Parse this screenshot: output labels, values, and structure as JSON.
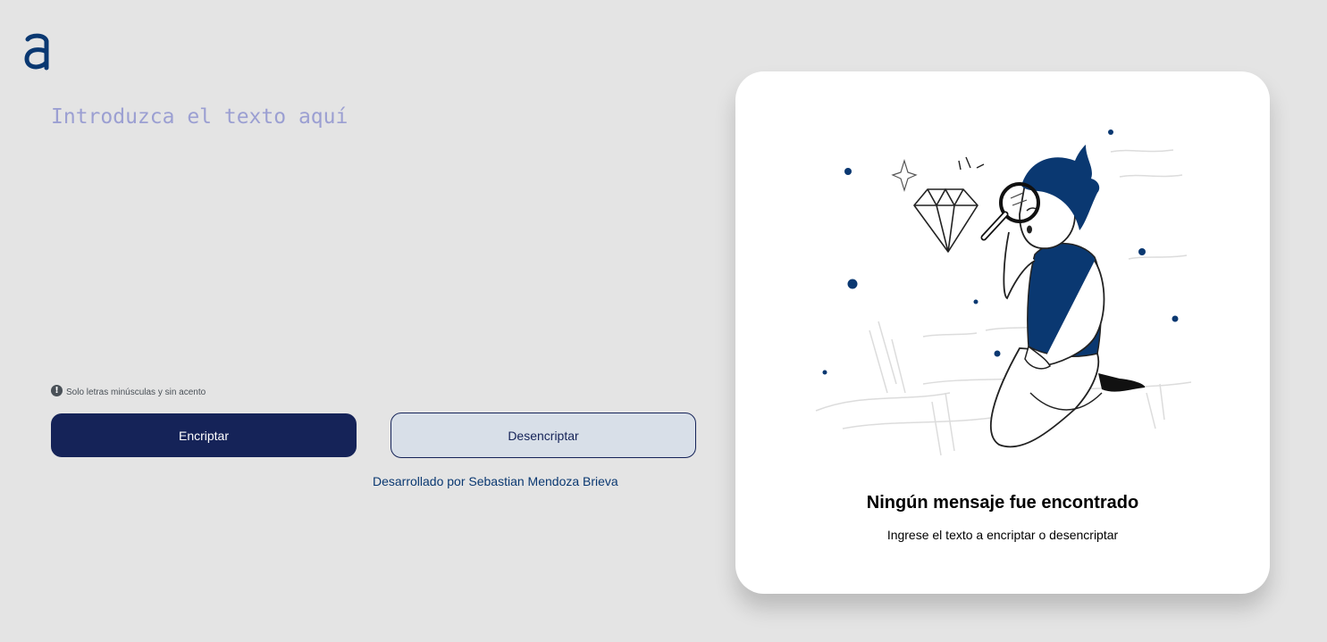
{
  "app": {
    "logo_icon": "alura-logo-icon"
  },
  "input": {
    "placeholder": "Introduzca el texto aquí",
    "value": ""
  },
  "hint": {
    "icon": "exclamation-circle-icon",
    "text": "Solo letras minúsculas y sin acento"
  },
  "buttons": {
    "encrypt_label": "Encriptar",
    "decrypt_label": "Desencriptar"
  },
  "footer": {
    "text": "Desarrollado por Sebastian Mendoza Brieva"
  },
  "output": {
    "illustration": "magnifying-glass-person-diamond-illustration",
    "title": "Ningún mensaje fue encontrado",
    "subtitle": "Ingrese el texto a encriptar o desencriptar"
  },
  "colors": {
    "background": "#e4e4e4",
    "primary": "#152358",
    "accent": "#0a3871",
    "placeholder": "#9b9fd2",
    "secondary_button": "#d8dfe8",
    "card": "#ffffff"
  }
}
